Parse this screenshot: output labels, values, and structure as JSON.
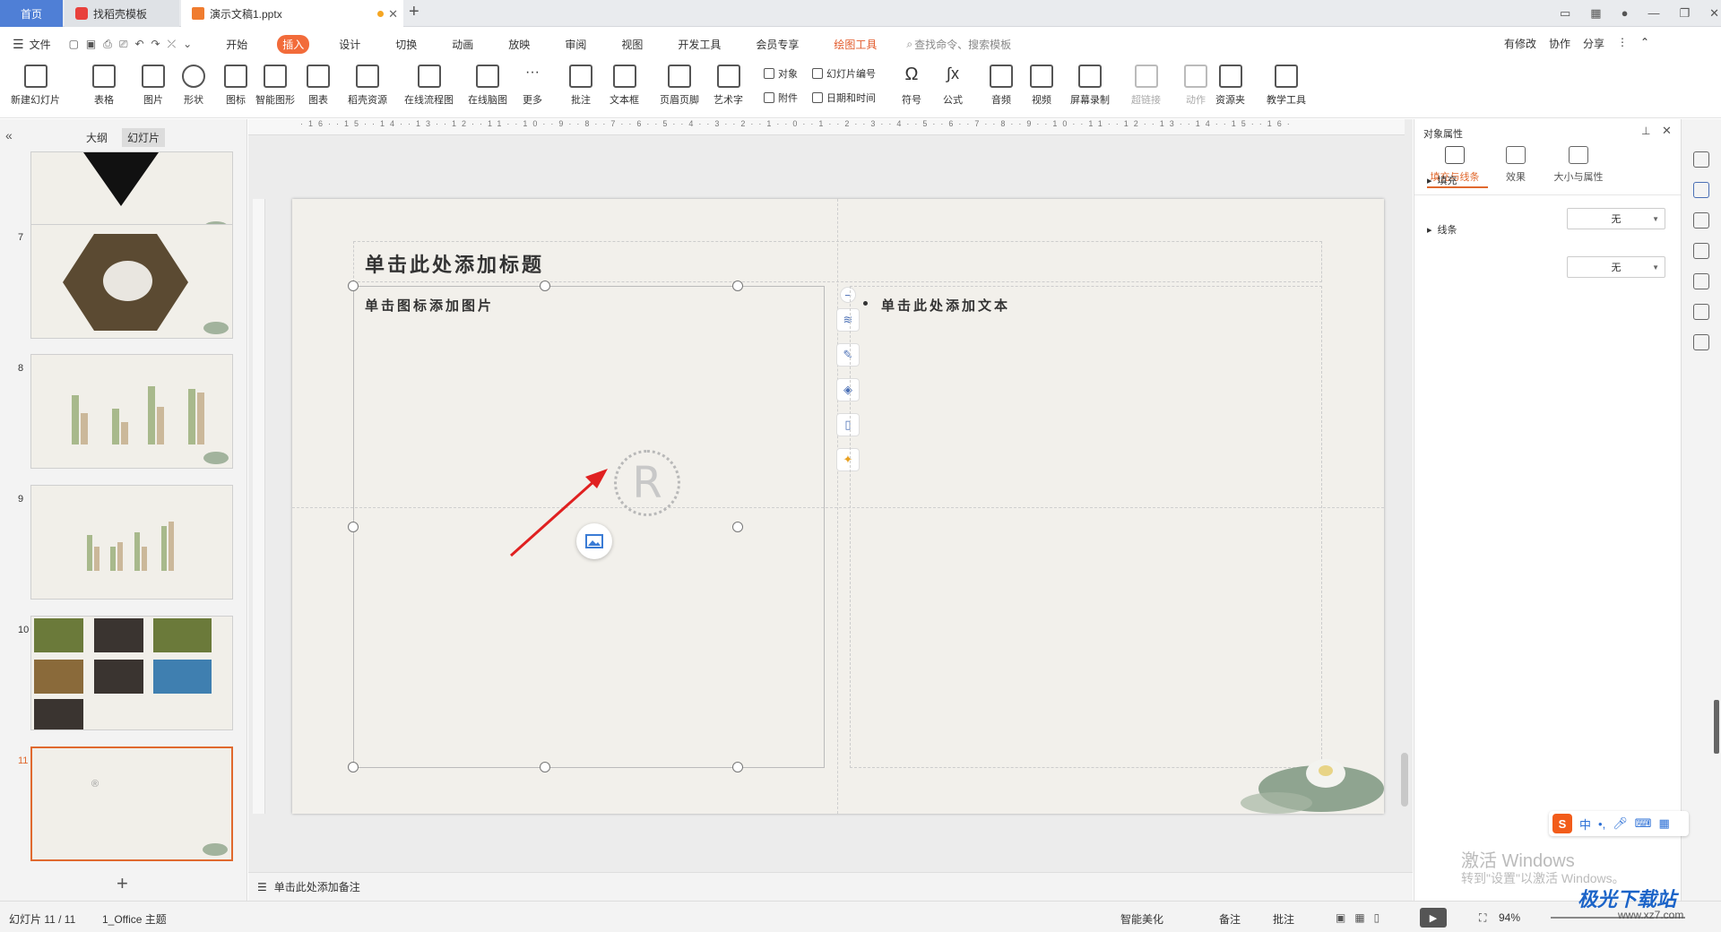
{
  "tabs": {
    "home": "首页",
    "templates": "找稻壳模板",
    "document": "演示文稿1.pptx"
  },
  "menu": {
    "file": "文件",
    "items": [
      "开始",
      "插入",
      "设计",
      "切换",
      "动画",
      "放映",
      "审阅",
      "视图",
      "开发工具",
      "会员专享"
    ],
    "active": "插入",
    "drawing_tools": "绘图工具",
    "search_placeholder": "查找命令、搜索模板",
    "has_changes": "有修改",
    "collaborate": "协作",
    "share": "分享"
  },
  "ribbon": {
    "new_slide": "新建幻灯片",
    "table": "表格",
    "picture": "图片",
    "shape": "形状",
    "icon": "图标",
    "smart_shape": "智能图形",
    "chart": "图表",
    "docer_resources": "稻壳资源",
    "online_flowchart": "在线流程图",
    "online_mindmap": "在线脑图",
    "more": "更多",
    "comment": "批注",
    "textbox": "文本框",
    "header_footer": "页眉页脚",
    "wordart": "艺术字",
    "object": "对象",
    "attachment": "附件",
    "slide_number": "幻灯片编号",
    "date_time": "日期和时间",
    "symbol": "符号",
    "formula": "公式",
    "audio": "音频",
    "video": "视频",
    "screen_record": "屏幕录制",
    "hyperlink": "超链接",
    "action": "动作",
    "resource_folder": "资源夹",
    "teaching_tools": "教学工具"
  },
  "leftpanel": {
    "tab_outline": "大纲",
    "tab_slides": "幻灯片",
    "thumb_numbers": [
      "7",
      "8",
      "9",
      "10",
      "11"
    ],
    "add_label": "+"
  },
  "slide": {
    "title_placeholder": "单击此处添加标题",
    "picture_placeholder": "单击图标添加图片",
    "text_placeholder": "单击此处添加文本",
    "logo_char": "R"
  },
  "notes": {
    "placeholder": "单击此处添加备注"
  },
  "rightpanel": {
    "title": "对象属性",
    "tab_fill_line": "填充与线条",
    "tab_effects": "效果",
    "tab_size": "大小与属性",
    "fill_label": "填充",
    "fill_value": "无",
    "line_label": "线条",
    "line_value": "无"
  },
  "statusbar": {
    "slide_count": "幻灯片 11 / 11",
    "theme": "1_Office 主题",
    "smart_beautify": "智能美化",
    "notes": "备注",
    "comments": "批注",
    "zoom": "94%"
  },
  "overlays": {
    "activate_title": "激活 Windows",
    "activate_sub": "转到\"设置\"以激活 Windows。",
    "site_name": "极光下载站",
    "site_url": "www.xz7.com"
  },
  "colors": {
    "accent": "#e0692e",
    "home_tab": "#4f7fd6",
    "active_menu": "#f26b3a",
    "slide_bg": "#f2f0eb"
  }
}
